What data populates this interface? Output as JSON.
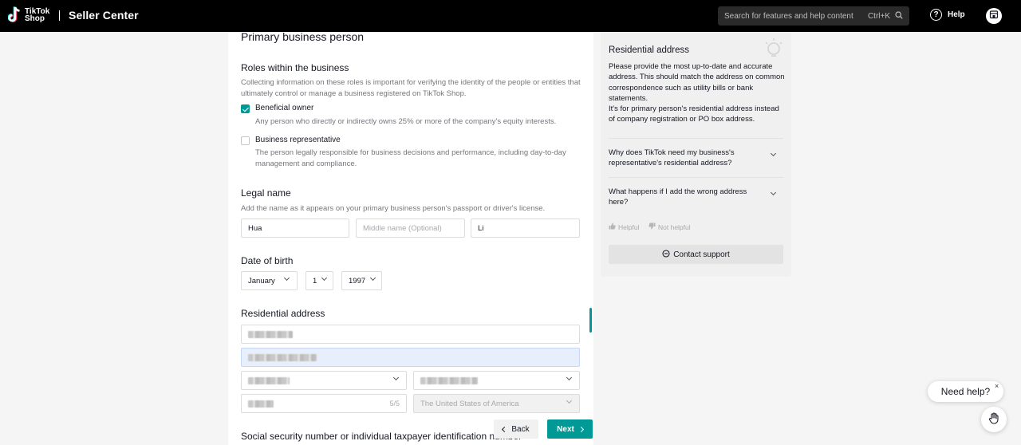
{
  "header": {
    "logo_line1": "TikTok",
    "logo_line2": "Shop",
    "app_title": "Seller Center",
    "search_placeholder": "Search for features and help content",
    "search_shortcut": "Ctrl+K",
    "help_label": "Help"
  },
  "form": {
    "section_title": "Primary business person",
    "roles": {
      "title": "Roles within the business",
      "hint": "Collecting information on these roles is important for verifying the identity of the people or entities that ultimately control or manage a business registered on TikTok Shop.",
      "options": [
        {
          "label": "Beneficial owner",
          "desc": "Any person who directly or indirectly owns 25% or more of the company's equity interests.",
          "checked": true
        },
        {
          "label": "Business representative",
          "desc": "The person legally responsible for business decisions and performance, including day-to-day management and compliance.",
          "checked": false
        }
      ]
    },
    "legal_name": {
      "title": "Legal name",
      "hint": "Add the name as it appears on your primary business person's passport or driver's license.",
      "first": "Hua",
      "middle_placeholder": "Middle name (Optional)",
      "last": "Li"
    },
    "dob": {
      "title": "Date of birth",
      "month": "January",
      "day": "1",
      "year": "1997"
    },
    "address": {
      "title": "Residential address",
      "zip_counter": "5/5",
      "country": "The United States of America"
    },
    "ssn_title": "Social security number or individual taxpayer identification number"
  },
  "nav": {
    "back": "Back",
    "next": "Next"
  },
  "side": {
    "title": "Residential address",
    "body_1": "Please provide the most up-to-date and accurate address. This should match the address on common correspondence such as utility bills or bank statements.",
    "body_2": "It's for primary person's residential address instead of company registration or PO box address.",
    "faq": [
      {
        "q": "Why does TikTok need my business's representative's residential address?"
      },
      {
        "q": "What happens if I add the wrong address here?"
      }
    ],
    "helpful": "Helpful",
    "not_helpful": "Not helpful",
    "contact": "Contact support"
  },
  "widget": {
    "need_help": "Need help?",
    "close": "×"
  },
  "colors": {
    "accent": "#009995",
    "topbar": "#000000"
  }
}
